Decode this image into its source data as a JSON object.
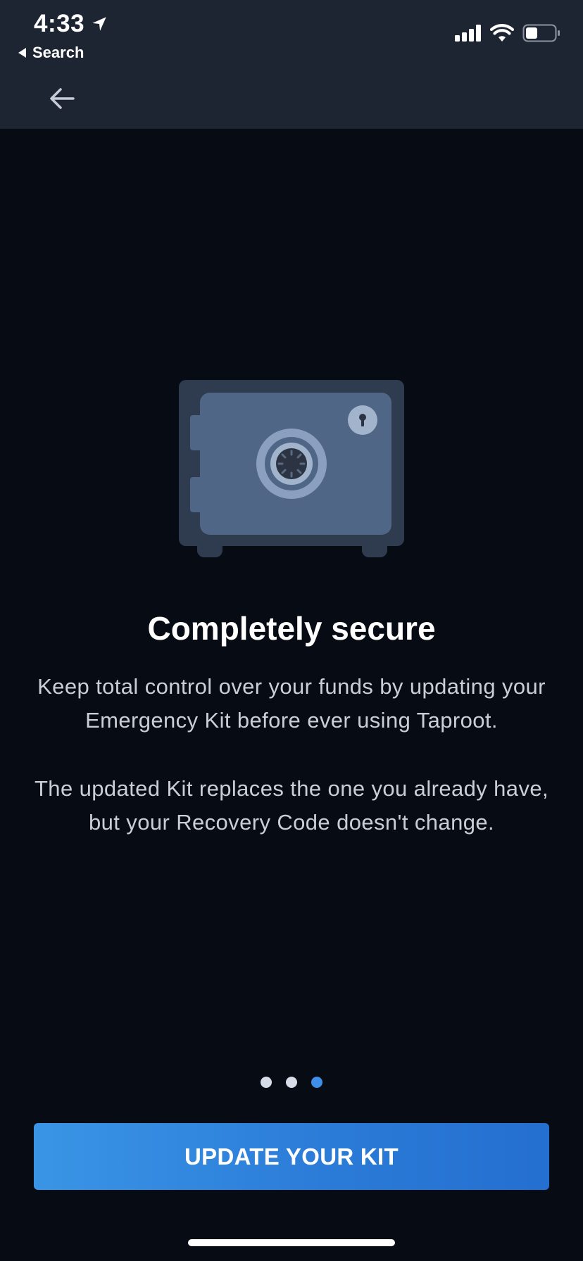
{
  "status_bar": {
    "time": "4:33",
    "back_app_label": "Search"
  },
  "page": {
    "title": "Completely secure",
    "paragraph_1": "Keep total control over your funds by updating your Emergency Kit before ever using Taproot.",
    "paragraph_2": "The updated Kit replaces the one you already have, but your Recovery Code doesn't change."
  },
  "pagination": {
    "total": 3,
    "active_index": 2
  },
  "cta": {
    "label": "UPDATE YOUR KIT"
  },
  "colors": {
    "background": "#070b14",
    "header": "#1d2432",
    "accent": "#3a8fe6",
    "safe_body": "#2f3b4f",
    "safe_door": "#4f6686"
  },
  "icons": [
    "location-arrow-icon",
    "back-triangle-icon",
    "signal-icon",
    "wifi-icon",
    "battery-icon",
    "arrow-left-icon",
    "safe-illustration"
  ]
}
